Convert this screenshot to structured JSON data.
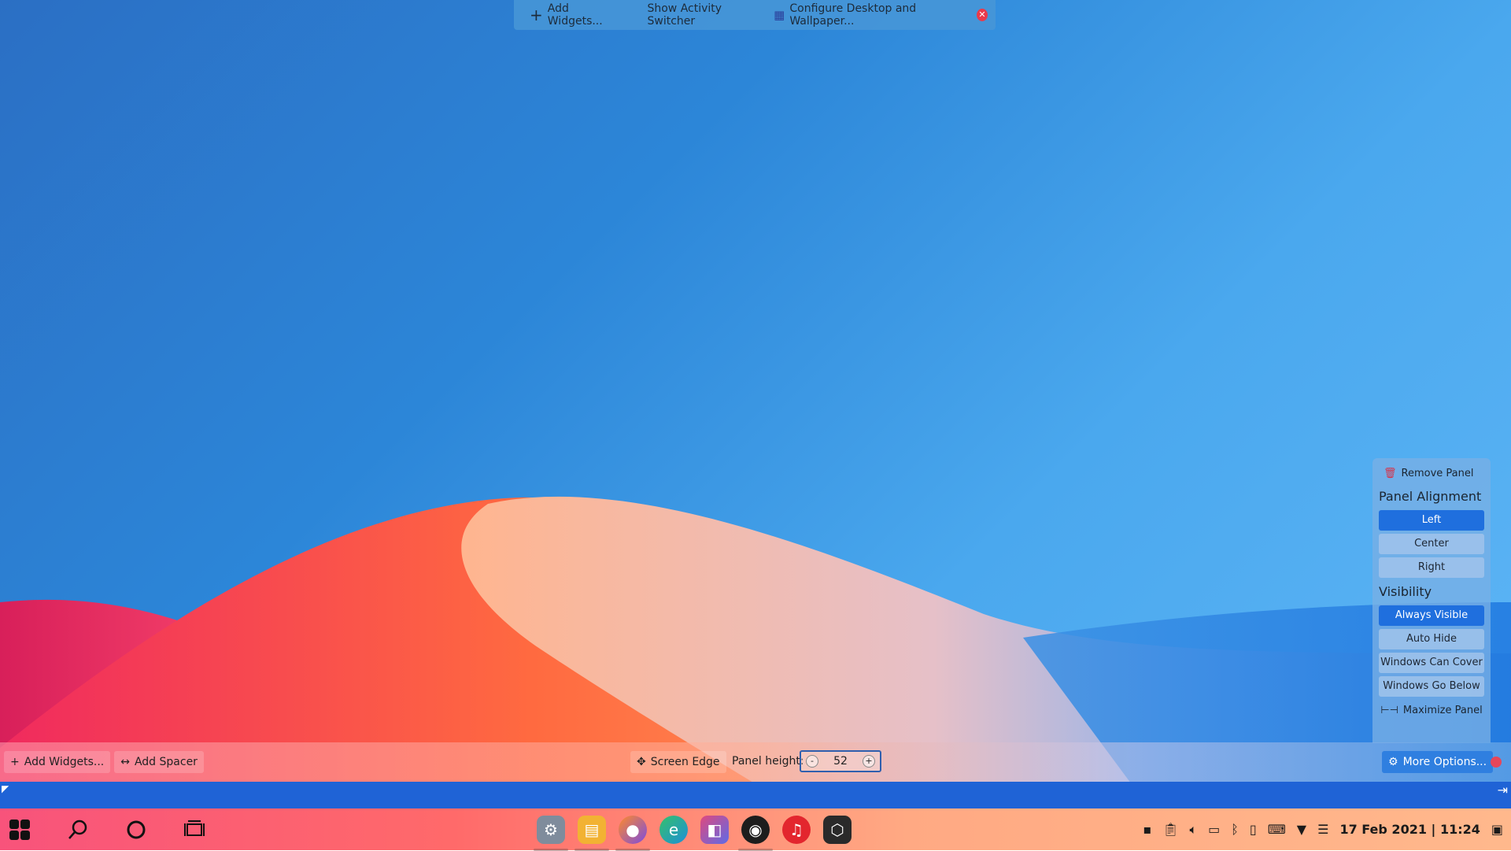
{
  "top_toolbar": {
    "add_widgets": "Add Widgets...",
    "activity_switcher": "Show Activity Switcher",
    "configure_desktop": "Configure Desktop and Wallpaper..."
  },
  "panel_popup": {
    "remove_panel": "Remove Panel",
    "alignment_heading": "Panel Alignment",
    "alignment_options": [
      "Left",
      "Center",
      "Right"
    ],
    "alignment_selected": "Left",
    "visibility_heading": "Visibility",
    "visibility_options": [
      "Always Visible",
      "Auto Hide",
      "Windows Can Cover",
      "Windows Go Below"
    ],
    "visibility_selected": "Always Visible",
    "maximize_panel": "Maximize Panel"
  },
  "edit_bar": {
    "add_widgets": "Add Widgets...",
    "add_spacer": "Add Spacer",
    "screen_edge": "Screen Edge",
    "panel_height_label": "Panel height:",
    "panel_height_value": "52",
    "decrement": "-",
    "increment": "+",
    "more_options": "More Options..."
  },
  "taskbar": {
    "left_icons": [
      "start-menu-icon",
      "search-icon",
      "cortana-icon",
      "task-view-icon"
    ],
    "apps": [
      {
        "name": "system-settings-icon",
        "color": "#6f7f92"
      },
      {
        "name": "file-manager-icon",
        "color": "#f2b233"
      },
      {
        "name": "firefox-icon",
        "color": "#7b4ce0"
      },
      {
        "name": "edge-icon",
        "color": "#1e8fd8"
      },
      {
        "name": "store-icon",
        "color": "#8c5fe0"
      },
      {
        "name": "github-icon",
        "color": "#1d1d1d"
      },
      {
        "name": "netease-music-icon",
        "color": "#e3262e"
      },
      {
        "name": "app-icon",
        "color": "#2a2a2a"
      }
    ],
    "tray_icons": [
      "chat-icon",
      "clipboard-icon",
      "volume-icon",
      "battery-icon",
      "bluetooth-icon",
      "phone-icon",
      "keyboard-icon",
      "wifi-icon",
      "list-icon"
    ],
    "clock": "17 Feb 2021 | 11:24"
  }
}
